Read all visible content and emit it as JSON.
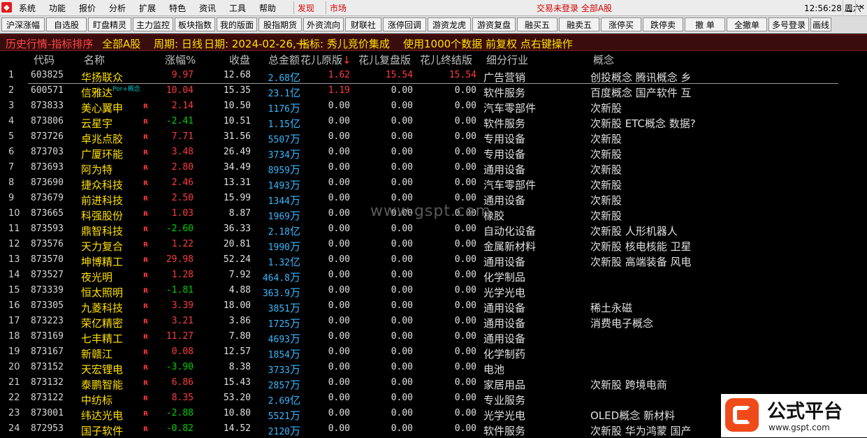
{
  "menubar": {
    "items": [
      "系统",
      "功能",
      "报价",
      "分析",
      "扩展",
      "特色",
      "资讯",
      "工具",
      "帮助"
    ],
    "hot_items": [
      "发现",
      "市场"
    ],
    "status": "交易未登录  全部A股",
    "clock": "12:56:28 周六"
  },
  "toolbar": [
    "沪深涨幅",
    "自选股",
    "盯盘精灵",
    "主力监控",
    "板块指数",
    "我的版面",
    "股指期货",
    "外资流向",
    "财联社",
    "涨停回调",
    "游资龙虎",
    "游资复盘",
    "融买五",
    "融卖五",
    "涨停买",
    "跌停卖",
    "撤 单",
    "全撤单",
    "多号登录",
    "画线"
  ],
  "infobar": {
    "title": "历史行情-指标排序",
    "market": "全部A股",
    "period": "周期: 日线",
    "date": "日期: 2024-02-26,一",
    "indicator": "指标: 秀儿竞价集成",
    "note": "使用1000个数据 前复权 点右键操作"
  },
  "columns": {
    "code": "代码",
    "name": "名称",
    "chg": "涨幅%",
    "price": "收盘",
    "amount": "总金额",
    "v1": "花儿原版",
    "v1_sort": "↓",
    "v2": "花儿复盘版",
    "v3": "花儿终结版",
    "industry": "细分行业",
    "concept": "概念"
  },
  "rows": [
    {
      "idx": "1",
      "code": "603825",
      "name": "华扬联众",
      "r": "",
      "chg": "9.97",
      "dir": "up",
      "price": "12.68",
      "amt": "2.68",
      "unit": "亿",
      "v1": "1.62",
      "v2": "15.54",
      "v3": "15.54",
      "ind": "广告营销",
      "concept": "创投概念 腾讯概念 乡"
    },
    {
      "idx": "2",
      "code": "600571",
      "name": "信雅达",
      "r": "",
      "chg": "10.04",
      "dir": "up",
      "price": "15.35",
      "amt": "23.1",
      "unit": "亿",
      "v1": "1.19",
      "v2": "0.00",
      "v3": "0.00",
      "ind": "软件服务",
      "concept": "百度概念 国产软件 互"
    },
    {
      "idx": "3",
      "code": "873833",
      "name": "美心翼申",
      "r": "R",
      "chg": "2.14",
      "dir": "up",
      "price": "10.50",
      "amt": "1176",
      "unit": "万",
      "v1": "0.00",
      "v2": "0.00",
      "v3": "0.00",
      "ind": "汽车零部件",
      "concept": "次新股"
    },
    {
      "idx": "4",
      "code": "873806",
      "name": "云星宇",
      "r": "R",
      "chg": "-2.41",
      "dir": "down",
      "price": "10.51",
      "amt": "1.15",
      "unit": "亿",
      "v1": "0.00",
      "v2": "0.00",
      "v3": "0.00",
      "ind": "软件服务",
      "concept": "次新股 ETC概念 数据?"
    },
    {
      "idx": "5",
      "code": "873726",
      "name": "卓兆点胶",
      "r": "R",
      "chg": "7.71",
      "dir": "up",
      "price": "31.56",
      "amt": "5507",
      "unit": "万",
      "v1": "0.00",
      "v2": "0.00",
      "v3": "0.00",
      "ind": "专用设备",
      "concept": "次新股"
    },
    {
      "idx": "6",
      "code": "873703",
      "name": "广厦环能",
      "r": "R",
      "chg": "3.48",
      "dir": "up",
      "price": "26.49",
      "amt": "3734",
      "unit": "万",
      "v1": "0.00",
      "v2": "0.00",
      "v3": "0.00",
      "ind": "专用设备",
      "concept": "次新股"
    },
    {
      "idx": "7",
      "code": "873693",
      "name": "阿为特",
      "r": "R",
      "chg": "2.80",
      "dir": "up",
      "price": "34.49",
      "amt": "8959",
      "unit": "万",
      "v1": "0.00",
      "v2": "0.00",
      "v3": "0.00",
      "ind": "通用设备",
      "concept": "次新股"
    },
    {
      "idx": "8",
      "code": "873690",
      "name": "捷众科技",
      "r": "R",
      "chg": "2.46",
      "dir": "up",
      "price": "13.31",
      "amt": "1493",
      "unit": "万",
      "v1": "0.00",
      "v2": "0.00",
      "v3": "0.00",
      "ind": "汽车零部件",
      "concept": "次新股"
    },
    {
      "idx": "9",
      "code": "873679",
      "name": "前进科技",
      "r": "R",
      "chg": "2.50",
      "dir": "up",
      "price": "15.99",
      "amt": "1344",
      "unit": "万",
      "v1": "0.00",
      "v2": "0.00",
      "v3": "0.00",
      "ind": "通用设备",
      "concept": "次新股"
    },
    {
      "idx": "10",
      "code": "873665",
      "name": "科强股份",
      "r": "R",
      "chg": "1.03",
      "dir": "up",
      "price": "8.87",
      "amt": "1969",
      "unit": "万",
      "v1": "0.00",
      "v2": "0.00",
      "v3": "0.00",
      "ind": "橡胶",
      "concept": "次新股"
    },
    {
      "idx": "11",
      "code": "873593",
      "name": "鼎智科技",
      "r": "R",
      "chg": "-2.60",
      "dir": "down",
      "price": "36.33",
      "amt": "2.18",
      "unit": "亿",
      "v1": "0.00",
      "v2": "0.00",
      "v3": "0.00",
      "ind": "自动化设备",
      "concept": "次新股 人形机器人"
    },
    {
      "idx": "12",
      "code": "873576",
      "name": "天力复合",
      "r": "R",
      "chg": "1.22",
      "dir": "up",
      "price": "20.81",
      "amt": "1990",
      "unit": "万",
      "v1": "0.00",
      "v2": "0.00",
      "v3": "0.00",
      "ind": "金属新材料",
      "concept": "次新股 核电核能 卫星"
    },
    {
      "idx": "13",
      "code": "873570",
      "name": "坤博精工",
      "r": "R",
      "chg": "29.98",
      "dir": "up",
      "price": "52.24",
      "amt": "1.32",
      "unit": "亿",
      "v1": "0.00",
      "v2": "0.00",
      "v3": "0.00",
      "ind": "通用设备",
      "concept": "次新股 高端装备 风电"
    },
    {
      "idx": "14",
      "code": "873527",
      "name": "夜光明",
      "r": "R",
      "chg": "1.28",
      "dir": "up",
      "price": "7.92",
      "amt": "464.8",
      "unit": "万",
      "v1": "0.00",
      "v2": "0.00",
      "v3": "0.00",
      "ind": "化学制品",
      "concept": ""
    },
    {
      "idx": "15",
      "code": "873339",
      "name": "恒太照明",
      "r": "R",
      "chg": "-1.81",
      "dir": "down",
      "price": "4.88",
      "amt": "363.9",
      "unit": "万",
      "v1": "0.00",
      "v2": "0.00",
      "v3": "0.00",
      "ind": "光学光电",
      "concept": ""
    },
    {
      "idx": "16",
      "code": "873305",
      "name": "九菱科技",
      "r": "R",
      "chg": "3.39",
      "dir": "up",
      "price": "18.00",
      "amt": "3851",
      "unit": "万",
      "v1": "0.00",
      "v2": "0.00",
      "v3": "0.00",
      "ind": "通用设备",
      "concept": "稀土永磁"
    },
    {
      "idx": "17",
      "code": "873223",
      "name": "荣亿精密",
      "r": "R",
      "chg": "3.21",
      "dir": "up",
      "price": "3.86",
      "amt": "1725",
      "unit": "万",
      "v1": "0.00",
      "v2": "0.00",
      "v3": "0.00",
      "ind": "通用设备",
      "concept": "消费电子概念"
    },
    {
      "idx": "18",
      "code": "873169",
      "name": "七丰精工",
      "r": "R",
      "chg": "11.27",
      "dir": "up",
      "price": "7.80",
      "amt": "4693",
      "unit": "万",
      "v1": "0.00",
      "v2": "0.00",
      "v3": "0.00",
      "ind": "通用设备",
      "concept": ""
    },
    {
      "idx": "19",
      "code": "873167",
      "name": "新赣江",
      "r": "R",
      "chg": "0.08",
      "dir": "up",
      "price": "12.57",
      "amt": "1854",
      "unit": "万",
      "v1": "0.00",
      "v2": "0.00",
      "v3": "0.00",
      "ind": "化学制药",
      "concept": ""
    },
    {
      "idx": "20",
      "code": "873152",
      "name": "天宏锂电",
      "r": "R",
      "chg": "-3.90",
      "dir": "down",
      "price": "8.38",
      "amt": "3733",
      "unit": "万",
      "v1": "0.00",
      "v2": "0.00",
      "v3": "0.00",
      "ind": "电池",
      "concept": ""
    },
    {
      "idx": "21",
      "code": "873132",
      "name": "泰鹏智能",
      "r": "R",
      "chg": "6.86",
      "dir": "up",
      "price": "15.43",
      "amt": "2857",
      "unit": "万",
      "v1": "0.00",
      "v2": "0.00",
      "v3": "0.00",
      "ind": "家居用品",
      "concept": "次新股 跨境电商"
    },
    {
      "idx": "22",
      "code": "873122",
      "name": "中纺标",
      "r": "R",
      "chg": "8.35",
      "dir": "up",
      "price": "53.20",
      "amt": "2.69",
      "unit": "亿",
      "v1": "0.00",
      "v2": "0.00",
      "v3": "0.00",
      "ind": "专业服务",
      "concept": ""
    },
    {
      "idx": "23",
      "code": "873001",
      "name": "纬达光电",
      "r": "R",
      "chg": "-2.88",
      "dir": "down",
      "price": "10.80",
      "amt": "5521",
      "unit": "万",
      "v1": "0.00",
      "v2": "0.00",
      "v3": "0.00",
      "ind": "光学光电",
      "concept": "OLED概念 新材料"
    },
    {
      "idx": "24",
      "code": "872953",
      "name": "国子软件",
      "r": "R",
      "chg": "-0.82",
      "dir": "down",
      "price": "14.52",
      "amt": "2120",
      "unit": "万",
      "v1": "0.00",
      "v2": "0.00",
      "v3": "0.00",
      "ind": "软件服务",
      "concept": "次新股 华为鸿蒙 国产"
    }
  ],
  "row_tag": "Por+概念",
  "watermark": "www.gspt.com",
  "brand": {
    "title": "公式平台",
    "url": "www.gspt.com"
  },
  "colors": {
    "up": "#ff3c3c",
    "down": "#00d000",
    "amount": "#38b8ff",
    "name": "#ffe000",
    "infobar_bg": "#3a0d0d"
  }
}
